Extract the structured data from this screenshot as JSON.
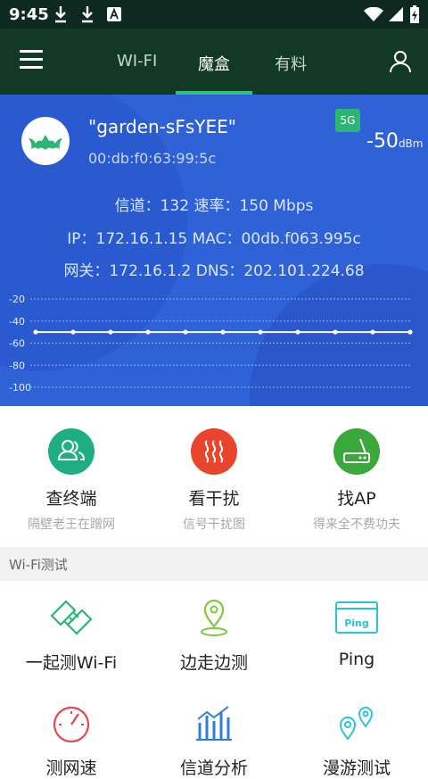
{
  "status_bar": {
    "time": "9:45"
  },
  "app_bar": {
    "tabs": [
      {
        "label": "WI-FI",
        "active": false
      },
      {
        "label": "魔盒",
        "active": true
      },
      {
        "label": "有料",
        "active": false
      }
    ],
    "accent_color": "#2ec27e"
  },
  "wifi_panel": {
    "ssid": "\"garden-sFsYEE\"",
    "bssid": "00:db:f0:63:99:5c",
    "band_badge": "5G",
    "signal_value": "-50",
    "signal_unit": "dBm",
    "channel_line": "信道：132  速率：150 Mbps",
    "ip_line": "IP：172.16.1.15  MAC：00db.f063.995c",
    "gateway_line": "网关：172.16.1.2  DNS：202.101.224.68",
    "background_color": "#2f62d7"
  },
  "chart_data": {
    "type": "line",
    "y_ticks": [
      "-20",
      "-40",
      "-60",
      "-80",
      "-100"
    ],
    "ylim": [
      -100,
      -20
    ],
    "values": [
      -50,
      -50,
      -50,
      -50,
      -50,
      -50,
      -50,
      -50,
      -50,
      -50,
      -50
    ],
    "grid": true
  },
  "features": [
    {
      "title": "查终端",
      "subtitle": "隔壁老王在蹭网",
      "icon": "users-icon",
      "color": "#1fae84"
    },
    {
      "title": "看干扰",
      "subtitle": "信号干扰图",
      "icon": "heat-waves-icon",
      "color": "#e8452c"
    },
    {
      "title": "找AP",
      "subtitle": "得来全不费功夫",
      "icon": "router-icon",
      "color": "#3aa83a"
    }
  ],
  "section_title": "Wi-Fi测试",
  "tools": [
    {
      "label": "一起测Wi-Fi",
      "icon": "handshake-icon"
    },
    {
      "label": "边走边测",
      "icon": "location-pin-icon"
    },
    {
      "label": "Ping",
      "icon": "ping-window-icon",
      "icon_text": "Ping"
    },
    {
      "label": "测网速",
      "icon": "speedometer-icon"
    },
    {
      "label": "信道分析",
      "icon": "bar-chart-icon"
    },
    {
      "label": "漫游测试",
      "icon": "roaming-pins-icon"
    }
  ]
}
